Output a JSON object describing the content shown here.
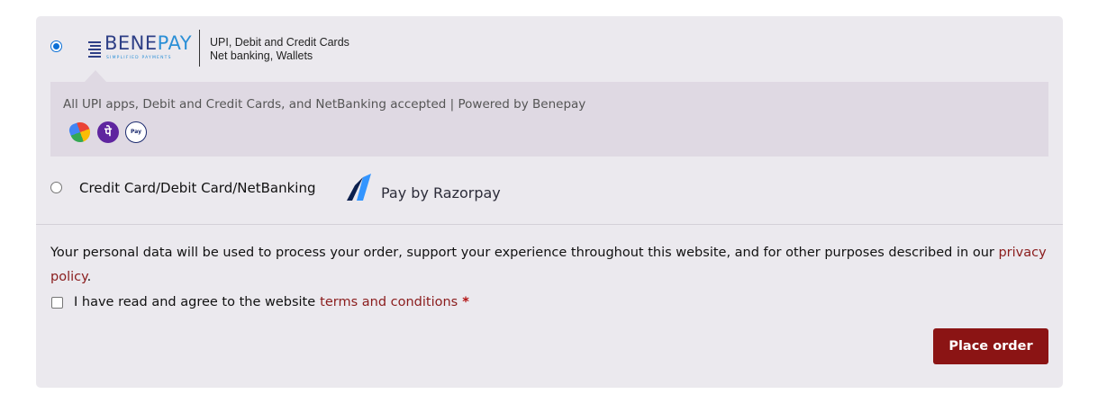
{
  "payment_methods": {
    "benepay": {
      "selected": true,
      "logo_word_1": "BENE",
      "logo_word_2": "PAY",
      "logo_tagline": "SIMPLIFIED PAYMENTS",
      "line_1": "UPI, Debit and Credit Cards",
      "line_2": "Net banking, Wallets",
      "description": "All UPI apps, Debit and Credit Cards, and NetBanking accepted | Powered by Benepay",
      "app_icons": [
        "google-pay-icon",
        "phonepe-icon",
        "paytm-icon"
      ]
    },
    "razorpay": {
      "selected": false,
      "label": "Credit Card/Debit Card/NetBanking",
      "logo_text": "Pay by Razorpay"
    }
  },
  "privacy": {
    "text": "Your personal data will be used to process your order, support your experience throughout this website, and for other purposes described in our",
    "link": "privacy policy",
    "end": "."
  },
  "terms": {
    "checked": false,
    "text": "I have read and agree to the website",
    "link": "terms and conditions",
    "required_mark": "*"
  },
  "place_order_label": "Place order",
  "colors": {
    "accent": "#8b1414",
    "radio": "#0b6fd6",
    "panel": "#ebe9ee",
    "description_box": "#dfd9e3",
    "benepay_navy": "#2e3f86",
    "benepay_blue": "#2b8fd6"
  }
}
